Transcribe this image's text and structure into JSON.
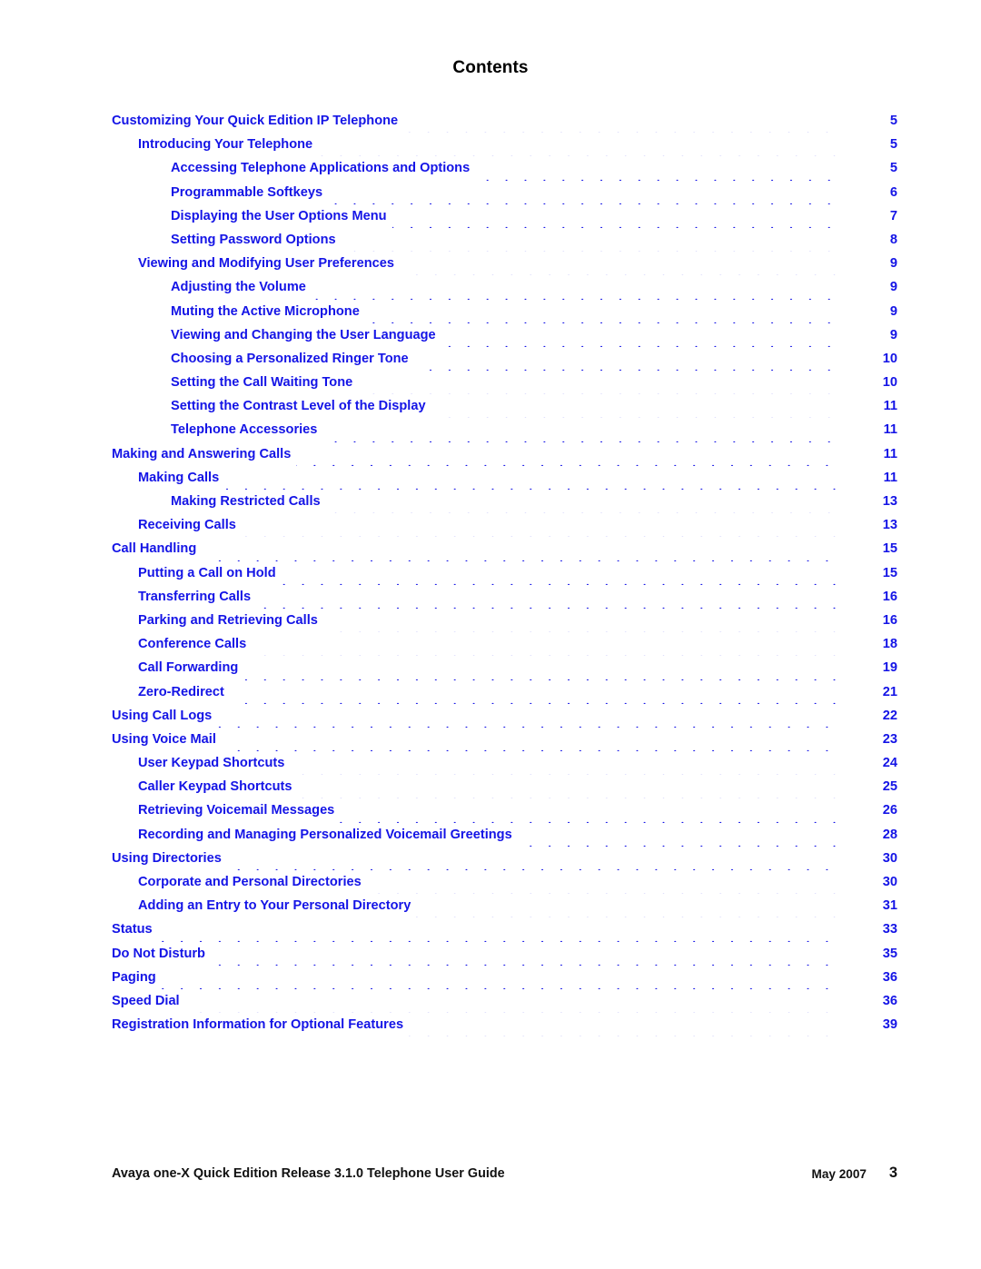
{
  "document": {
    "title": "Contents",
    "accent_color": "#1414E6",
    "title_color": "#000000"
  },
  "toc": {
    "entries": [
      {
        "label": "Customizing Your Quick Edition IP Telephone",
        "page": "5",
        "level": 0
      },
      {
        "label": "Introducing Your Telephone",
        "page": "5",
        "level": 1
      },
      {
        "label": "Accessing Telephone Applications and Options",
        "page": "5",
        "level": 2
      },
      {
        "label": "Programmable Softkeys",
        "page": "6",
        "level": 2
      },
      {
        "label": "Displaying the User Options Menu",
        "page": "7",
        "level": 2
      },
      {
        "label": "Setting Password Options",
        "page": "8",
        "level": 2
      },
      {
        "label": "Viewing and Modifying User Preferences",
        "page": "9",
        "level": 1
      },
      {
        "label": "Adjusting the Volume",
        "page": "9",
        "level": 2
      },
      {
        "label": "Muting the Active Microphone",
        "page": "9",
        "level": 2
      },
      {
        "label": "Viewing and Changing the User Language",
        "page": "9",
        "level": 2
      },
      {
        "label": "Choosing a Personalized Ringer Tone",
        "page": "10",
        "level": 2
      },
      {
        "label": "Setting the Call Waiting Tone",
        "page": "10",
        "level": 2
      },
      {
        "label": "Setting the Contrast Level of the Display",
        "page": "11",
        "level": 2
      },
      {
        "label": "Telephone Accessories",
        "page": "11",
        "level": 2
      },
      {
        "label": "Making and Answering Calls",
        "page": "11",
        "level": 0
      },
      {
        "label": "Making Calls",
        "page": "11",
        "level": 1
      },
      {
        "label": "Making Restricted Calls",
        "page": "13",
        "level": 2
      },
      {
        "label": "Receiving Calls",
        "page": "13",
        "level": 1
      },
      {
        "label": "Call Handling",
        "page": "15",
        "level": 0
      },
      {
        "label": "Putting a Call on Hold",
        "page": "15",
        "level": 1
      },
      {
        "label": "Transferring Calls",
        "page": "16",
        "level": 1
      },
      {
        "label": "Parking and Retrieving Calls",
        "page": "16",
        "level": 1
      },
      {
        "label": "Conference Calls",
        "page": "18",
        "level": 1
      },
      {
        "label": "Call Forwarding",
        "page": "19",
        "level": 1
      },
      {
        "label": "Zero-Redirect",
        "page": "21",
        "level": 1
      },
      {
        "label": "Using Call Logs",
        "page": "22",
        "level": 0
      },
      {
        "label": "Using Voice Mail",
        "page": "23",
        "level": 0
      },
      {
        "label": "User Keypad Shortcuts",
        "page": "24",
        "level": 1
      },
      {
        "label": "Caller Keypad Shortcuts",
        "page": "25",
        "level": 1
      },
      {
        "label": "Retrieving Voicemail Messages",
        "page": "26",
        "level": 1
      },
      {
        "label": "Recording and Managing Personalized Voicemail Greetings",
        "page": "28",
        "level": 1
      },
      {
        "label": "Using Directories",
        "page": "30",
        "level": 0
      },
      {
        "label": "Corporate and Personal Directories",
        "page": "30",
        "level": 1
      },
      {
        "label": "Adding an Entry to Your Personal Directory",
        "page": "31",
        "level": 1
      },
      {
        "label": "Status",
        "page": "33",
        "level": 0
      },
      {
        "label": "Do Not Disturb",
        "page": "35",
        "level": 0
      },
      {
        "label": "Paging",
        "page": "36",
        "level": 0
      },
      {
        "label": "Speed Dial",
        "page": "36",
        "level": 0
      },
      {
        "label": "Registration Information for Optional Features",
        "page": "39",
        "level": 0
      }
    ]
  },
  "footer": {
    "guide_title": "Avaya one-X Quick Edition Release 3.1.0 Telephone User Guide",
    "date": "May 2007",
    "page_number": "3"
  }
}
